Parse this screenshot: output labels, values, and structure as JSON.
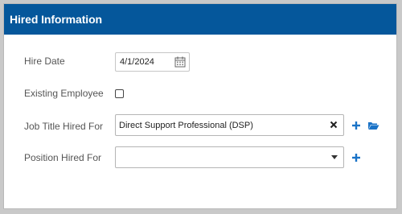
{
  "panel": {
    "title": "Hired Information"
  },
  "colors": {
    "header_bg": "#05579b",
    "accent_icon": "#1a73c7"
  },
  "fields": {
    "hire_date": {
      "label": "Hire Date",
      "value": "4/1/2024",
      "icon": "calendar-icon"
    },
    "existing_employee": {
      "label": "Existing Employee",
      "checked": false
    },
    "job_title": {
      "label": "Job Title Hired For",
      "value": "Direct Support Professional (DSP)",
      "icons": [
        "clear-icon",
        "add-icon",
        "folder-open-icon"
      ]
    },
    "position": {
      "label": "Position Hired For",
      "value": "",
      "icons": [
        "chevron-down-icon",
        "add-icon"
      ]
    }
  }
}
